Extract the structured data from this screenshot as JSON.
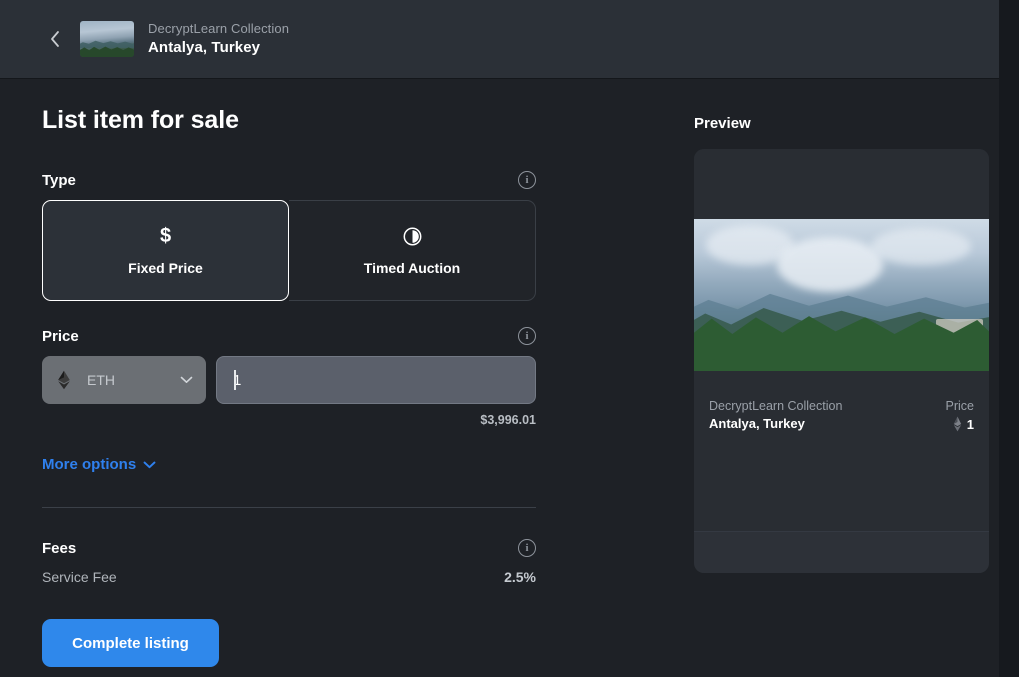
{
  "colors": {
    "page_bg": "#1e2126",
    "header_bg": "#2b3037",
    "accent_blue": "#2f88eb",
    "link_blue": "#2f80ed",
    "card_bg": "#292d33",
    "selected_card_bg": "#2c3138",
    "input_bg": "#5b606b",
    "select_bg": "#6b6f74"
  },
  "header": {
    "back_icon": "chevron-left-icon",
    "thumbnail_icon": "item-thumbnail",
    "collection": "DecryptLearn Collection",
    "title": "Antalya, Turkey"
  },
  "main": {
    "page_title": "List item for sale",
    "type": {
      "label": "Type",
      "info_icon": "info-icon",
      "options": [
        {
          "label": "Fixed Price",
          "icon": "dollar-icon",
          "glyph": "$",
          "selected": true
        },
        {
          "label": "Timed Auction",
          "icon": "clock-icon",
          "glyph": "",
          "selected": false
        }
      ]
    },
    "price": {
      "label": "Price",
      "info_icon": "info-icon",
      "currency": "ETH",
      "currency_icon": "ethereum-icon",
      "dropdown_icon": "chevron-down-icon",
      "value": "1",
      "placeholder": "Amount",
      "usd_estimate": "$3,996.01"
    },
    "more_options": {
      "label": "More options",
      "icon": "chevron-down-icon"
    },
    "fees": {
      "label": "Fees",
      "info_icon": "info-icon",
      "rows": [
        {
          "name": "Service Fee",
          "value": "2.5%"
        }
      ]
    },
    "submit": {
      "label": "Complete listing"
    }
  },
  "preview": {
    "label": "Preview",
    "card": {
      "artwork_icon": "landscape-artwork",
      "collection": "DecryptLearn Collection",
      "title": "Antalya, Turkey",
      "price_label": "Price",
      "price_currency_icon": "ethereum-icon",
      "price_value": "1"
    }
  }
}
